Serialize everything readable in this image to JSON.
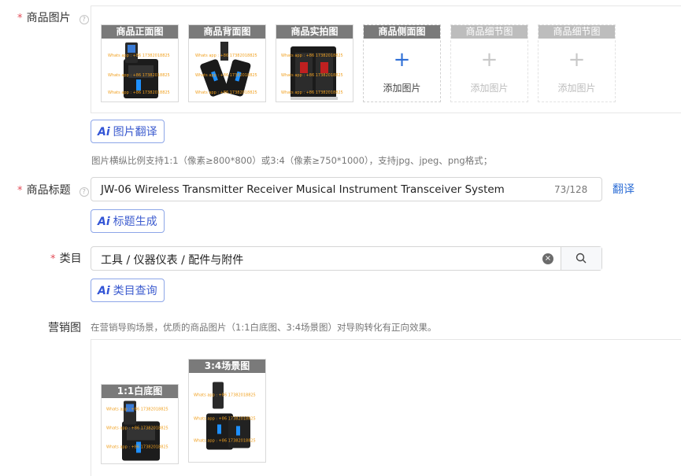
{
  "product_images": {
    "label": "商品图片",
    "help": "?",
    "tiles": [
      {
        "caption": "商品正面图",
        "filled": true
      },
      {
        "caption": "商品背面图",
        "filled": true
      },
      {
        "caption": "商品实拍图",
        "filled": true
      },
      {
        "caption": "商品侧面图",
        "filled": false,
        "add_label": "添加图片",
        "active": true
      },
      {
        "caption": "商品细节图",
        "filled": false,
        "add_label": "添加图片",
        "active": false
      },
      {
        "caption": "商品细节图",
        "filled": false,
        "add_label": "添加图片",
        "active": false
      }
    ],
    "ai_button": {
      "ai": "Ai",
      "text": "图片翻译"
    },
    "hint": "图片横纵比例支持1:1（像素≥800*800）或3:4（像素≥750*1000），支持jpg、jpeg、png格式；"
  },
  "title_field": {
    "label": "商品标题",
    "help": "?",
    "value": "JW-06 Wireless Transmitter Receiver Musical Instrument Transceiver System",
    "counter": "73/128",
    "translate_link": "翻译",
    "ai_button": {
      "ai": "Ai",
      "text": "标题生成"
    }
  },
  "category_field": {
    "label": "类目",
    "value": "工具 / 仪器仪表 / 配件与附件",
    "clear_icon": "clear-icon",
    "search_icon": "search-icon",
    "ai_button": {
      "ai": "Ai",
      "text": "类目查询"
    }
  },
  "marketing": {
    "label": "营销图",
    "hint": "在营销导购场景，优质的商品图片（1:1白底图、3:4场景图）对导购转化有正向效果。",
    "tiles": [
      {
        "caption": "1:1白底图"
      },
      {
        "caption": "3:4场景图"
      }
    ]
  },
  "required_mark": "*",
  "colors": {
    "accent": "#3d5ccf",
    "required": "#e34d59",
    "link": "#2f6fd6"
  }
}
